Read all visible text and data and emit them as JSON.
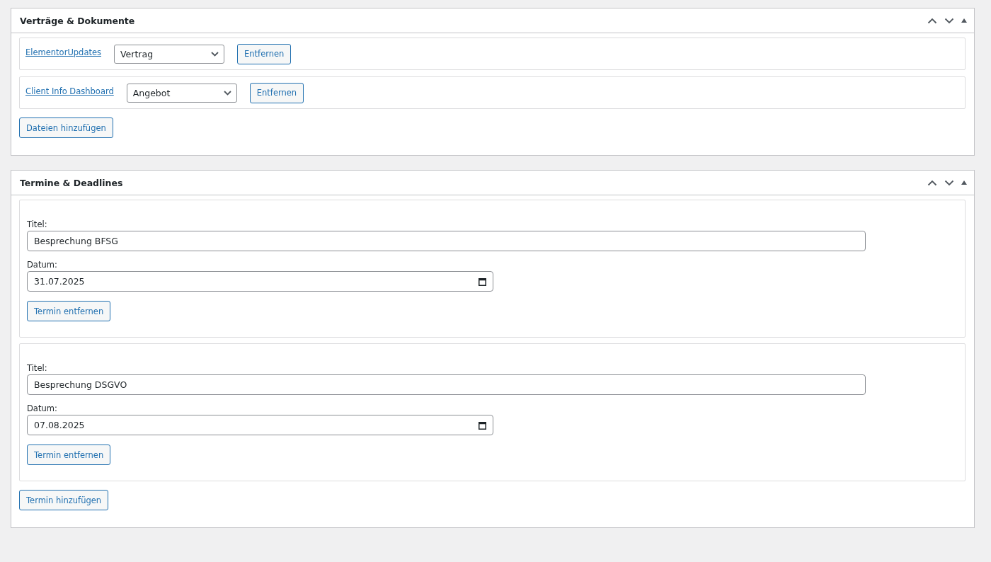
{
  "panels": [
    {
      "kind": "documents",
      "title": "Verträge & Dokumente",
      "files": [
        {
          "name": "ElementorUpdates",
          "type": "Vertrag",
          "remove_button": "Entfernen"
        },
        {
          "name": "Client Info Dashboard",
          "type": "Angebot",
          "remove_button": "Entfernen"
        }
      ],
      "add_button": "Dateien hinzufügen"
    },
    {
      "kind": "appointments",
      "title": "Termine & Deadlines",
      "appointments": [
        {
          "title_label": "Titel:",
          "title": "Besprechung BFSG",
          "date_label": "Datum:",
          "date": "31.07.2025",
          "remove_button": "Termin entfernen"
        },
        {
          "title_label": "Titel:",
          "title": "Besprechung DSGVO",
          "date_label": "Datum:",
          "date": "07.08.2025",
          "remove_button": "Termin entfernen"
        }
      ],
      "add_button": "Termin hinzufügen"
    }
  ]
}
